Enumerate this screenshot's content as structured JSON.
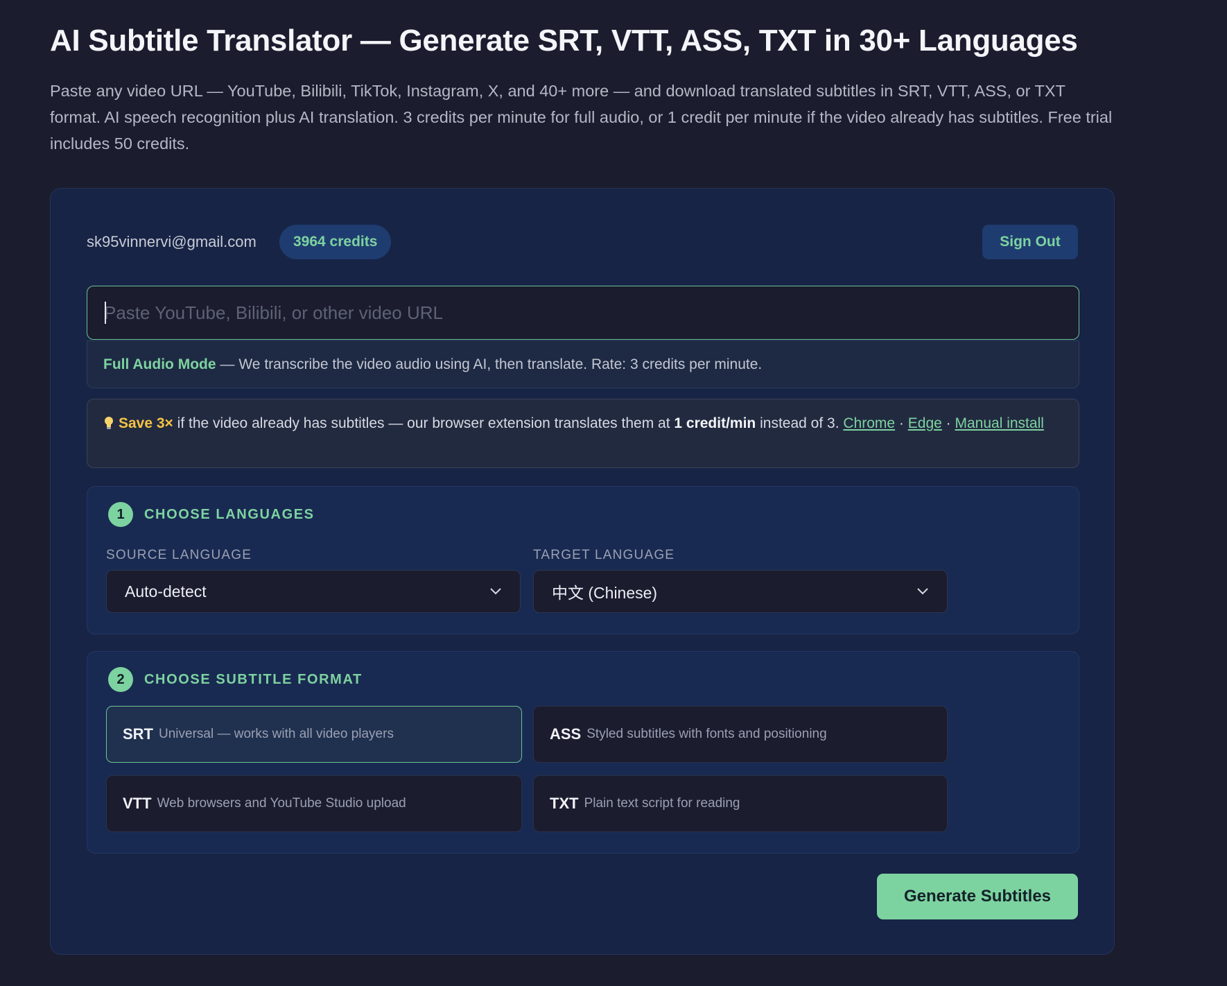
{
  "page": {
    "title": "AI Subtitle Translator — Generate SRT, VTT, ASS, TXT in 30+ Languages",
    "subtitle": "Paste any video URL — YouTube, Bilibili, TikTok, Instagram, X, and 40+ more — and download translated subtitles in SRT, VTT, ASS, or TXT format. AI speech recognition plus AI translation. 3 credits per minute for full audio, or 1 credit per minute if the video already has subtitles. Free trial includes 50 credits."
  },
  "account": {
    "email": "sk95vinnervi@gmail.com",
    "credits": "3964 credits",
    "sign_out_label": "Sign Out"
  },
  "url_input": {
    "placeholder": "Paste YouTube, Bilibili, or other video URL",
    "value": ""
  },
  "mode_note": {
    "highlight": "Full Audio Mode",
    "text": "— We transcribe the video audio using AI, then translate. Rate: 3 credits per minute."
  },
  "tip": {
    "save": "Save 3×",
    "text_before": "if the video already has subtitles — our browser extension translates them at",
    "rate": "1 credit/min",
    "text_after": "instead of 3.",
    "links": [
      "Chrome",
      "Edge",
      "Manual install"
    ],
    "separator": "·"
  },
  "step1": {
    "number": "1",
    "title": "CHOOSE LANGUAGES",
    "source_label": "SOURCE LANGUAGE",
    "source_value": "Auto-detect",
    "target_label": "TARGET LANGUAGE",
    "target_value": "中文 (Chinese)"
  },
  "step2": {
    "number": "2",
    "title": "CHOOSE SUBTITLE FORMAT",
    "formats": [
      {
        "name": "SRT",
        "desc": "Universal — works with all video players",
        "selected": true
      },
      {
        "name": "ASS",
        "desc": "Styled subtitles with fonts and positioning",
        "selected": false
      },
      {
        "name": "VTT",
        "desc": "Web browsers and YouTube Studio upload",
        "selected": false
      },
      {
        "name": "TXT",
        "desc": "Plain text script for reading",
        "selected": false
      }
    ]
  },
  "generate_label": "Generate Subtitles",
  "colors": {
    "background": "#1b1c2e",
    "card": "#172446",
    "accent": "#7dd3a0",
    "highlight_yellow": "#f6c343"
  },
  "icons": [
    "lightbulb-icon",
    "chevron-down-icon"
  ]
}
